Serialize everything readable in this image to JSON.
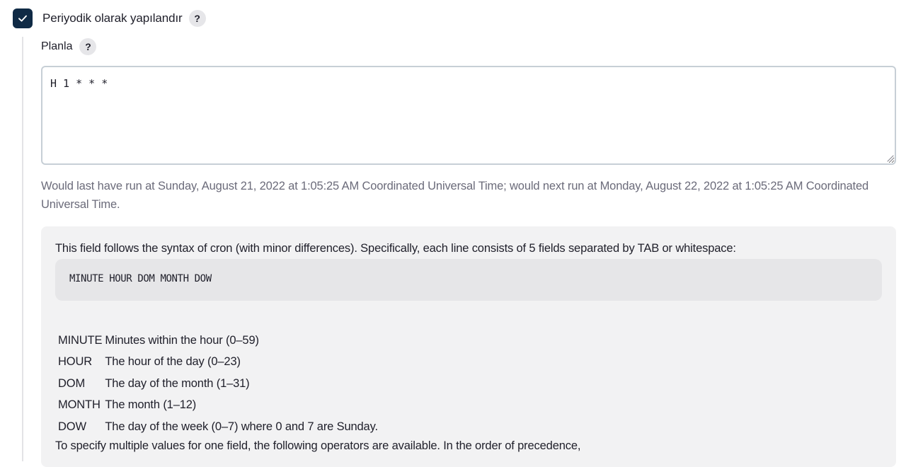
{
  "build_trigger": {
    "checkbox_label": "Periyodik olarak yapılandır",
    "checked": true,
    "help_label": "?"
  },
  "schedule": {
    "label": "Planla",
    "help_label": "?",
    "value": "H 1 * * *",
    "next_run_text": "Would last have run at Sunday, August 21, 2022 at 1:05:25 AM Coordinated Universal Time; would next run at Monday, August 22, 2022 at 1:05:25 AM Coordinated Universal Time."
  },
  "help": {
    "intro": "This field follows the syntax of cron (with minor differences). Specifically, each line consists of 5 fields separated by TAB or whitespace:",
    "syntax": "MINUTE HOUR DOM MONTH DOW",
    "fields": [
      {
        "name": "MINUTE",
        "description": "Minutes within the hour (0–59)"
      },
      {
        "name": "HOUR",
        "description": "The hour of the day (0–23)"
      },
      {
        "name": "DOM",
        "description": "The day of the month (1–31)"
      },
      {
        "name": "MONTH",
        "description": "The month (1–12)"
      },
      {
        "name": "DOW",
        "description": "The day of the week (0–7) where 0 and 7 are Sunday."
      }
    ],
    "operators_intro": "To specify multiple values for one field, the following operators are available. In the order of precedence,"
  },
  "colors": {
    "checkbox_fill": "#0f2a45",
    "help_button_bg": "#e6e6e9",
    "muted_text": "#6b6b7a",
    "panel_bg": "#f2f2f3",
    "code_bg": "#e6e6e8",
    "input_border": "#c7cfd6"
  },
  "icons": {
    "checkbox": "checkmark-icon",
    "resize": "resize-grip-icon"
  }
}
